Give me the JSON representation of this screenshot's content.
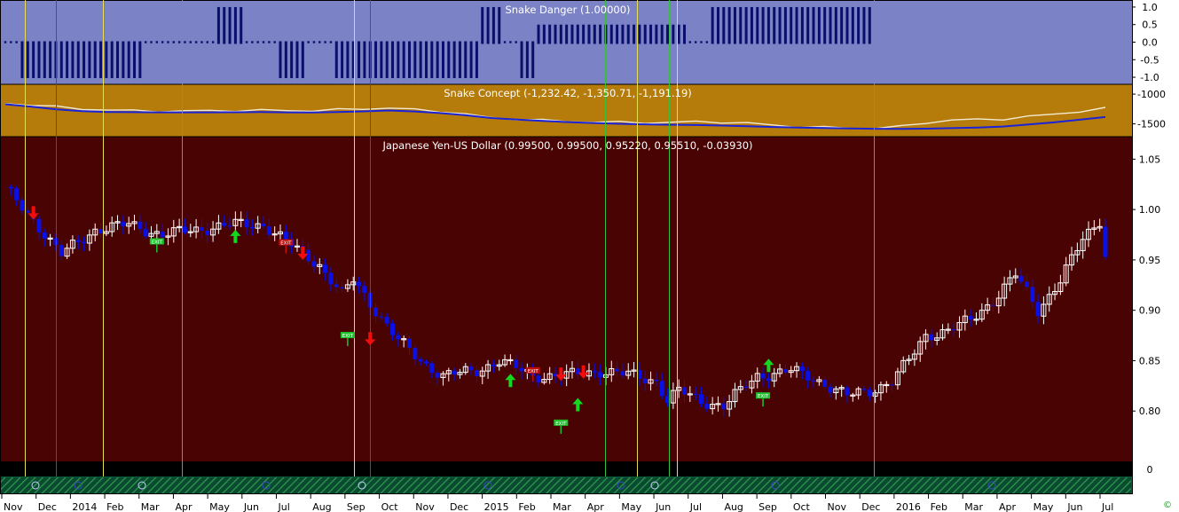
{
  "colors": {
    "danger_bg": "#7b83c6",
    "concept_bg": "#b57c0c",
    "main_bg": "#4a0303",
    "axis_bg": "#ffffff",
    "bull": "#ffffff",
    "bear": "#0a10e6",
    "line_fast": "#f2ead2",
    "line_slow": "#1a23d8",
    "vline_yellow": "#e6dd52",
    "vline_red": "#e61414",
    "vline_green": "#35c23a",
    "arrow_up": "#13d81f",
    "arrow_down": "#f20d0d",
    "exit_green": "#1bc52b",
    "exit_red": "#c20d0d"
  },
  "chart_data": [
    {
      "type": "bar",
      "title": "Snake Danger (1.00000)",
      "ylim": [
        -1.1,
        1.1
      ],
      "yticks": [
        "1.0",
        "0.5",
        "0.0",
        "-0.5",
        "-1.0"
      ],
      "segments": [
        {
          "from": 0,
          "to": 2,
          "value": 0
        },
        {
          "from": 3,
          "to": 24,
          "value": -1
        },
        {
          "from": 25,
          "to": 37,
          "value": 0
        },
        {
          "from": 38,
          "to": 42,
          "value": 1
        },
        {
          "from": 43,
          "to": 48,
          "value": 0
        },
        {
          "from": 49,
          "to": 53,
          "value": -1
        },
        {
          "from": 54,
          "to": 58,
          "value": 0
        },
        {
          "from": 59,
          "to": 84,
          "value": -1
        },
        {
          "from": 85,
          "to": 88,
          "value": 1
        },
        {
          "from": 89,
          "to": 91,
          "value": 0
        },
        {
          "from": 92,
          "to": 94,
          "value": -1
        },
        {
          "from": 95,
          "to": 121,
          "value": 0.5
        },
        {
          "from": 122,
          "to": 125,
          "value": 0
        },
        {
          "from": 126,
          "to": 154,
          "value": 1
        }
      ]
    },
    {
      "type": "line",
      "title": "Snake Concept (-1,232.42, -1,350.71, -1,191.19)",
      "ylim": [
        -1700,
        -850
      ],
      "yticks": [
        "-1000",
        "-1500"
      ],
      "series": [
        {
          "values": [
            -1160,
            -1180,
            -1215,
            -1250,
            -1265,
            -1280,
            -1285,
            -1285,
            -1280,
            -1275,
            -1272,
            -1275,
            -1278,
            -1262,
            -1245,
            -1235,
            -1260,
            -1288,
            -1340,
            -1400,
            -1420,
            -1440,
            -1460,
            -1468,
            -1475,
            -1480,
            -1475,
            -1465,
            -1470,
            -1490,
            -1520,
            -1548,
            -1560,
            -1568,
            -1575,
            -1545,
            -1478,
            -1440,
            -1425,
            -1418,
            -1380,
            -1335,
            -1290,
            -1240
          ]
        },
        {
          "values": [
            -1170,
            -1210,
            -1255,
            -1285,
            -1300,
            -1304,
            -1306,
            -1306,
            -1306,
            -1305,
            -1302,
            -1306,
            -1310,
            -1302,
            -1290,
            -1275,
            -1292,
            -1318,
            -1355,
            -1402,
            -1428,
            -1450,
            -1470,
            -1485,
            -1498,
            -1508,
            -1515,
            -1520,
            -1528,
            -1540,
            -1552,
            -1562,
            -1570,
            -1576,
            -1582,
            -1584,
            -1580,
            -1572,
            -1562,
            -1545,
            -1510,
            -1475,
            -1430,
            -1385
          ]
        }
      ]
    },
    {
      "type": "candlestick",
      "title": "Japanese Yen-US Dollar (0.99500, 0.99500, 0.95220, 0.95510, -0.03930)",
      "ylim": [
        0.75,
        1.06
      ],
      "yticks": [
        "1.05",
        "1.00",
        "0.95",
        "0.90",
        "0.85",
        "0.80"
      ],
      "xlabels": [
        "Nov",
        "Dec",
        "2014",
        "Feb",
        "Mar",
        "Apr",
        "May",
        "Jun",
        "Jul",
        "Aug",
        "Sep",
        "Oct",
        "Nov",
        "Dec",
        "2015",
        "Feb",
        "Mar",
        "Apr",
        "May",
        "Jun",
        "Jul",
        "Aug",
        "Sep",
        "Oct",
        "Nov",
        "Dec",
        "2016",
        "Feb",
        "Mar",
        "Apr",
        "May",
        "Jun",
        "Jul"
      ],
      "anchors": [
        [
          0,
          1.02
        ],
        [
          5,
          0.99
        ],
        [
          10,
          0.955
        ],
        [
          16,
          0.98
        ],
        [
          22,
          0.985
        ],
        [
          28,
          0.975
        ],
        [
          34,
          0.98
        ],
        [
          40,
          0.985
        ],
        [
          46,
          0.985
        ],
        [
          52,
          0.96
        ],
        [
          56,
          0.945
        ],
        [
          60,
          0.915
        ],
        [
          62,
          0.93
        ],
        [
          66,
          0.9
        ],
        [
          70,
          0.87
        ],
        [
          74,
          0.85
        ],
        [
          78,
          0.835
        ],
        [
          84,
          0.84
        ],
        [
          88,
          0.85
        ],
        [
          94,
          0.835
        ],
        [
          100,
          0.835
        ],
        [
          106,
          0.84
        ],
        [
          112,
          0.835
        ],
        [
          116,
          0.83
        ],
        [
          118,
          0.81
        ],
        [
          120,
          0.82
        ],
        [
          124,
          0.81
        ],
        [
          128,
          0.805
        ],
        [
          130,
          0.815
        ],
        [
          134,
          0.835
        ],
        [
          140,
          0.84
        ],
        [
          145,
          0.83
        ],
        [
          150,
          0.815
        ],
        [
          154,
          0.82
        ],
        [
          158,
          0.83
        ],
        [
          161,
          0.85
        ],
        [
          164,
          0.875
        ],
        [
          168,
          0.88
        ],
        [
          172,
          0.89
        ],
        [
          176,
          0.91
        ],
        [
          180,
          0.935
        ],
        [
          184,
          0.9
        ],
        [
          188,
          0.93
        ],
        [
          192,
          0.97
        ],
        [
          195,
          0.99
        ],
        [
          196,
          0.955
        ]
      ],
      "exit_label": "EXIT",
      "up_arrows": [
        [
          41,
          0.972
        ],
        [
          90,
          0.829
        ],
        [
          102,
          0.805
        ],
        [
          136,
          0.844
        ]
      ],
      "down_arrows": [
        [
          5,
          0.998
        ],
        [
          53,
          0.958
        ],
        [
          65,
          0.873
        ],
        [
          99,
          0.838
        ],
        [
          103,
          0.84
        ]
      ],
      "exit_green": [
        [
          27,
          0.968
        ],
        [
          61,
          0.875
        ],
        [
          99,
          0.788
        ],
        [
          135,
          0.815
        ]
      ],
      "exit_red": [
        [
          50,
          0.967
        ],
        [
          94,
          0.84
        ]
      ]
    }
  ],
  "markers": [
    {
      "x": 28,
      "color": "#e6dd52"
    },
    {
      "x": 63,
      "color": "#e61414"
    },
    {
      "x": 116,
      "color": "#e6dd52"
    },
    {
      "x": 205,
      "color": "#35c23a"
    },
    {
      "x": 399,
      "color": "#e6dd52"
    },
    {
      "x": 417,
      "color": "#e61414"
    },
    {
      "x": 682,
      "color": "#35c23a"
    },
    {
      "x": 718,
      "color": "#e6dd52"
    },
    {
      "x": 754,
      "color": "#35c23a"
    },
    {
      "x": 763,
      "color": "#e6dd52"
    },
    {
      "x": 985,
      "color": "#35c23a"
    }
  ],
  "bottom_axis_label": "0",
  "copyright_symbol": "©"
}
